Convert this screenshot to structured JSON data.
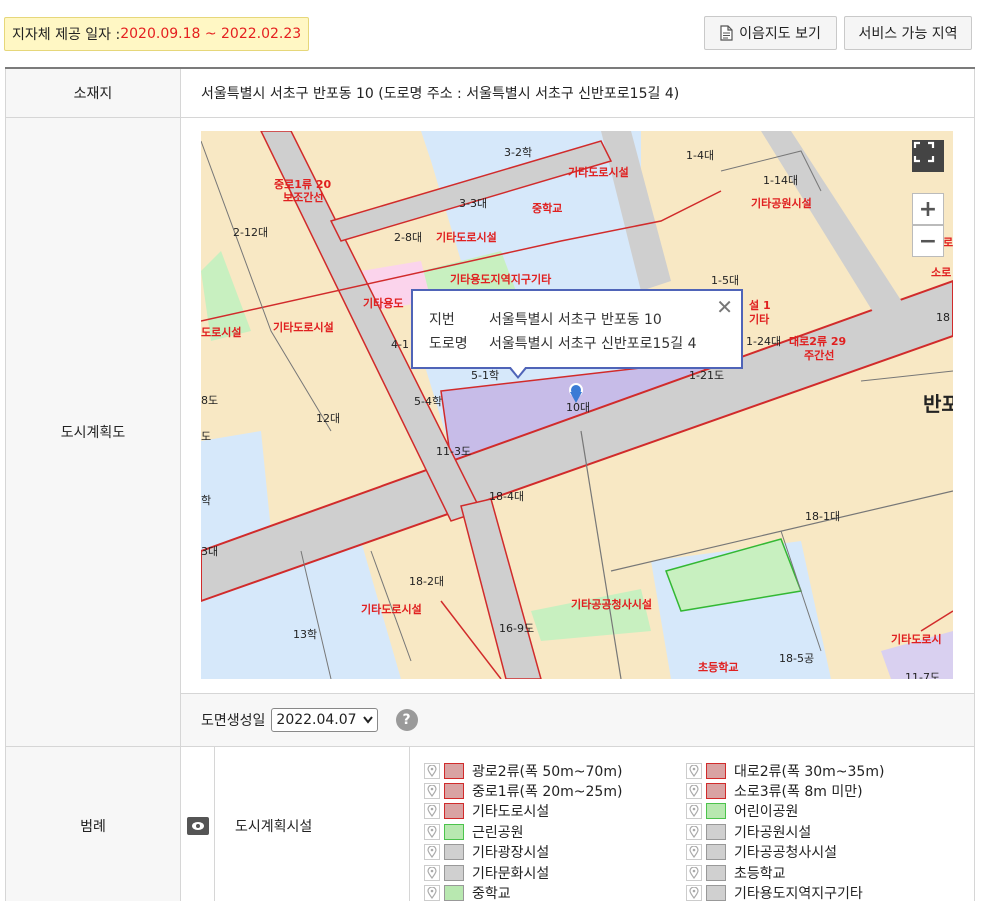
{
  "header": {
    "date_label": "지자체 제공 일자 : ",
    "date_range": "2020.09.18 ~ 2022.02.23",
    "map_button": "이음지도 보기",
    "service_button": "서비스 가능 지역"
  },
  "location": {
    "label": "소재지",
    "value": "서울특별시 서초구 반포동 10 (도로명 주소 : 서울특별시 서초구 신반포로15길 4)"
  },
  "plan_map": {
    "label": "도시계획도",
    "popup": {
      "jibun_label": "지번",
      "jibun_value": "서울특별시 서초구 반포동 10",
      "road_label": "도로명",
      "road_value": "서울특별시 서초구 신반포로15길 4"
    },
    "zoom_in": "+",
    "zoom_out": "−",
    "labels": {
      "l1": "3-2학",
      "l2": "기타도로시설",
      "l3": "1-4대",
      "l4": "중로1류 20",
      "l5": "보조간선",
      "l6": "3-3대",
      "l7": "중학교",
      "l8": "1-14대",
      "l9": "기타공원시설",
      "l10": "2-12대",
      "l11": "2-8대",
      "l12": "기타도로시설",
      "l13": "기타용도지역지구기타",
      "l14": "1-5대",
      "l15": "기타용도",
      "l16": "기타도로시설",
      "l17": "도로시설",
      "l18": "4-1",
      "l19": "설 1",
      "l20": "기타",
      "l21": "1-24대",
      "l22": "대로2류 29",
      "l23": "주간선",
      "l24": "5-1학",
      "l25": "1-21도",
      "l26": "10대",
      "l27": "5-4학",
      "l28": "12대",
      "l29": "반포",
      "l30": "11-3도",
      "l31": "18-4대",
      "l32": "18-1대",
      "l33": "18-2대",
      "l34": "기타도로시설",
      "l35": "기타공공청사시설",
      "l36": "13학",
      "l37": "16-9도",
      "l38": "기타도로시",
      "l39": "18-5공",
      "l40": "초등학교",
      "l41": "18",
      "l42": "소로",
      "l43": "로",
      "l44": "8도",
      "l45": "도",
      "l46": "학",
      "l47": "3대",
      "l48": "11-7도"
    }
  },
  "date_bar": {
    "label": "도면생성일",
    "selected": "2022.04.07",
    "help": "?"
  },
  "legend": {
    "label": "범례",
    "category": "도시계획시설",
    "items": [
      {
        "label": "광로2류(폭 50m~70m)",
        "color": "#d9a3a3",
        "border": "#d12b2b"
      },
      {
        "label": "대로2류(폭 30m~35m)",
        "color": "#d9a3a3",
        "border": "#d12b2b"
      },
      {
        "label": "중로1류(폭 20m~25m)",
        "color": "#d9a3a3",
        "border": "#d12b2b"
      },
      {
        "label": "소로3류(폭 8m 미만)",
        "color": "#d9a3a3",
        "border": "#d12b2b"
      },
      {
        "label": "기타도로시설",
        "color": "#d9a3a3",
        "border": "#d12b2b"
      },
      {
        "label": "어린이공원",
        "color": "#b8e8b0",
        "border": "#4cc34c"
      },
      {
        "label": "근린공원",
        "color": "#b8e8b0",
        "border": "#4cc34c"
      },
      {
        "label": "기타공원시설",
        "color": "#d0d0d0",
        "border": "#999999"
      },
      {
        "label": "기타광장시설",
        "color": "#d0d0d0",
        "border": "#999999"
      },
      {
        "label": "기타공공청사시설",
        "color": "#d0d0d0",
        "border": "#999999"
      },
      {
        "label": "기타문화시설",
        "color": "#d0d0d0",
        "border": "#999999"
      },
      {
        "label": "초등학교",
        "color": "#d0d0d0",
        "border": "#999999"
      },
      {
        "label": "중학교",
        "color": "#b8e8b0",
        "border": "#999999"
      },
      {
        "label": "기타용도지역지구기타",
        "color": "#d0d0d0",
        "border": "#999999"
      }
    ]
  }
}
